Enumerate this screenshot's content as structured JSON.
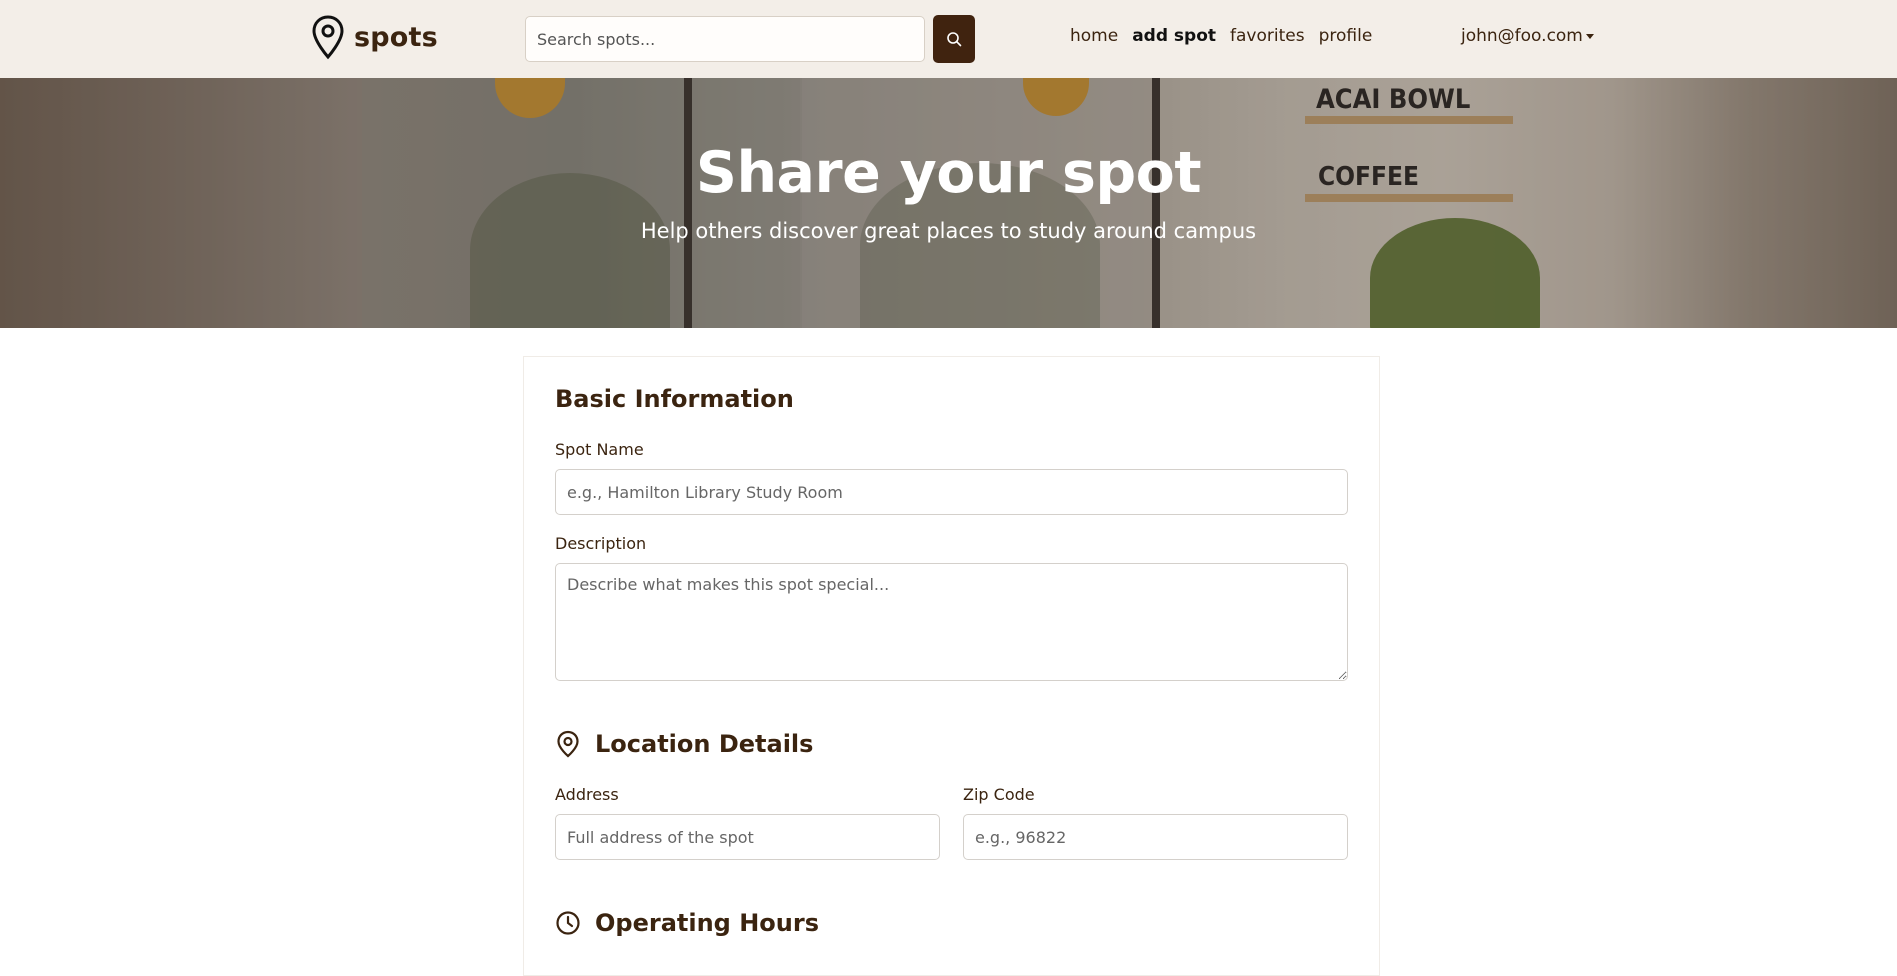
{
  "nav": {
    "brand": "spots",
    "search_placeholder": "Search spots...",
    "links": [
      "home",
      "add spot",
      "favorites",
      "profile"
    ],
    "active_link": "add spot",
    "user": "john@foo.com"
  },
  "hero": {
    "title": "Share your spot",
    "subtitle": "Help others discover great places to study around campus",
    "sign_top": "ACAI BOWL",
    "sign_bottom": "COFFEE"
  },
  "form": {
    "basic": {
      "title": "Basic Information",
      "spot_name_label": "Spot Name",
      "spot_name_placeholder": "e.g., Hamilton Library Study Room",
      "description_label": "Description",
      "description_placeholder": "Describe what makes this spot special..."
    },
    "location": {
      "title": "Location Details",
      "address_label": "Address",
      "address_placeholder": "Full address of the spot",
      "zip_label": "Zip Code",
      "zip_placeholder": "e.g., 96822"
    },
    "hours": {
      "title": "Operating Hours"
    }
  },
  "colors": {
    "brand_brown": "#3b2410",
    "button_brown": "#40230f",
    "navbar_bg": "#f3eee8"
  }
}
